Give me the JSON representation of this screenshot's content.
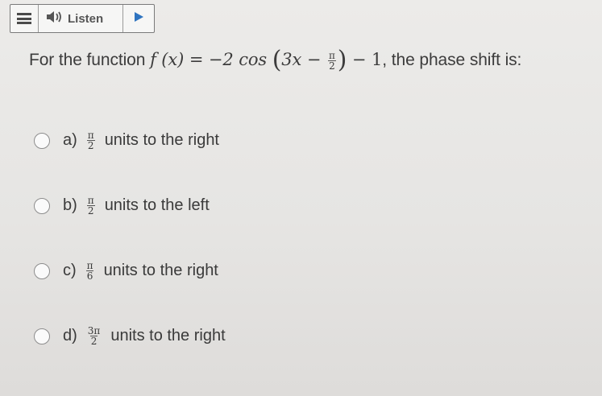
{
  "toolbar": {
    "menu_icon": "hamburger-menu-icon",
    "speaker_icon": "speaker-icon",
    "listen_label": "Listen",
    "play_icon": "play-icon",
    "play_color": "#2f74c0"
  },
  "question": {
    "prefix": "For the function ",
    "fx": "f (x) = −2 cos",
    "inner_left": "3x −",
    "frac_num": "π",
    "frac_den": "2",
    "after_paren": " − 1",
    "suffix": ", the phase shift is:"
  },
  "options": [
    {
      "letter": "a)",
      "num": "π",
      "den": "2",
      "text": "units to the right"
    },
    {
      "letter": "b)",
      "num": "π",
      "den": "2",
      "text": "units to the left"
    },
    {
      "letter": "c)",
      "num": "π",
      "den": "6",
      "text": "units to the right"
    },
    {
      "letter": "d)",
      "num": "3π",
      "den": "2",
      "text": "units to the right"
    }
  ]
}
